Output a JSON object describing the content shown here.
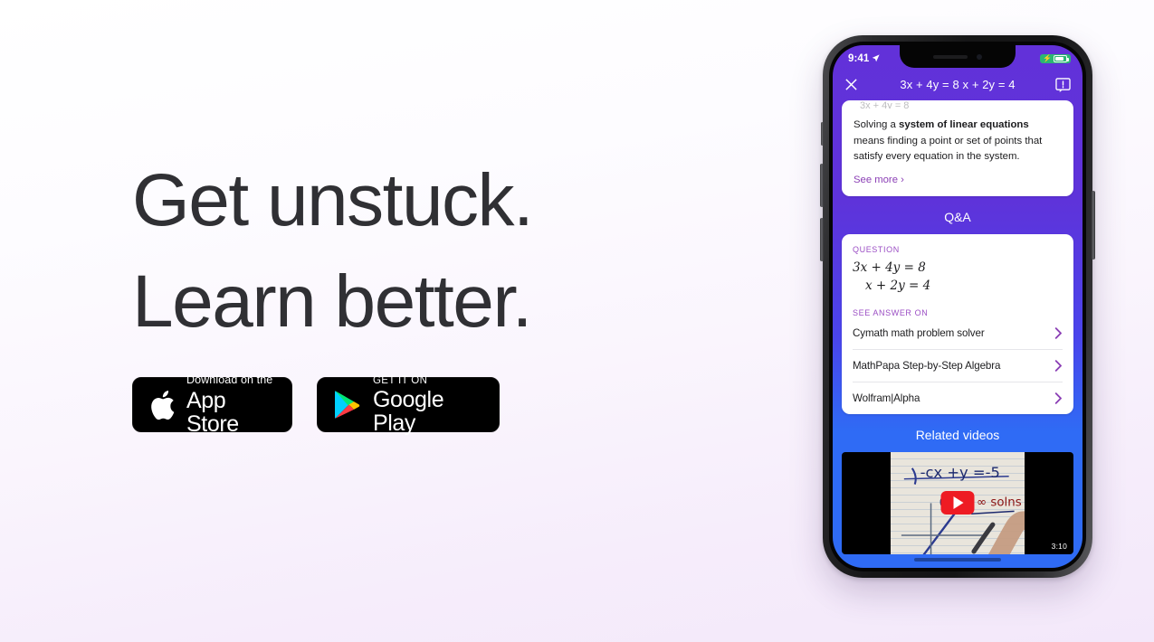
{
  "page": {
    "background_top": "#ffffff",
    "background_bottom": "#f3e8fa"
  },
  "hero": {
    "line1": "Get unstuck.",
    "line2": "Learn better.",
    "text_color": "#303034"
  },
  "store_badges": [
    {
      "id": "apple-app-store",
      "icon": "apple-logo-icon",
      "small_text": "Download on the",
      "big_text": "App Store"
    },
    {
      "id": "google-play",
      "icon": "google-play-logo-icon",
      "small_text": "GET IT ON",
      "big_text": "Google Play"
    }
  ],
  "phone": {
    "status_bar": {
      "time": "9:41",
      "location_icon": "location-arrow-icon",
      "battery_icon": "battery-charging-icon",
      "battery_color": "#2bb673"
    },
    "nav_bar": {
      "close_icon": "close-x-icon",
      "title": "3x + 4y = 8 x + 2y = 4",
      "feedback_icon": "feedback-icon"
    },
    "knowledge_card": {
      "clipped_line": "3x + 4y = 8",
      "body_lead": "Solving a ",
      "body_bold": "system of linear equations",
      "body_rest": " means finding a point or set of points that satisfy every equation in the system.",
      "see_more": "See more ›",
      "link_color": "#8b3fb5"
    },
    "qa": {
      "section_title": "Q&A",
      "question_label": "QUESTION",
      "equation_line1": "3x + 4y = 8",
      "equation_line2": "x + 2y = 4",
      "answers_label": "SEE ANSWER ON",
      "sources": [
        {
          "label": "Cymath math problem solver",
          "chevron": "chevron-right-icon"
        },
        {
          "label": "MathPapa Step-by-Step Algebra",
          "chevron": "chevron-right-icon"
        },
        {
          "label": "Wolfram|Alpha",
          "chevron": "chevron-right-icon"
        }
      ]
    },
    "videos": {
      "section_title": "Related videos",
      "play_icon": "youtube-play-icon",
      "duration": "3:10"
    },
    "screen_gradient": {
      "top": "#6231d9",
      "mid": "#4a45ec",
      "bottom": "#2f6bf5"
    }
  }
}
